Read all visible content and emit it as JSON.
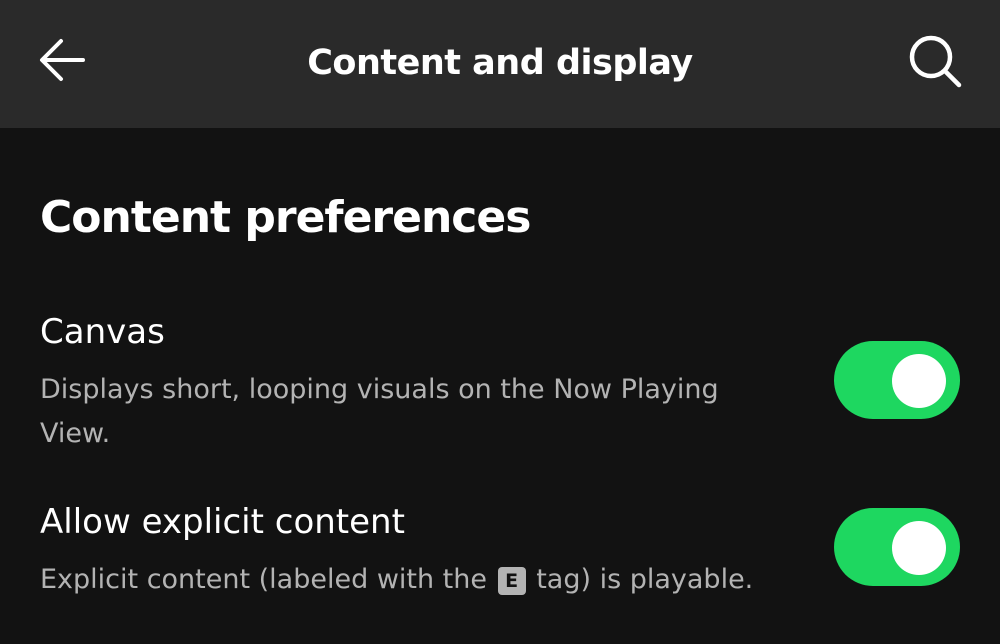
{
  "header": {
    "title": "Content and display",
    "back_icon": "arrow-left-icon",
    "search_icon": "search-icon"
  },
  "section": {
    "title": "Content preferences"
  },
  "settings": [
    {
      "label": "Canvas",
      "description": "Displays short, looping visuals on the Now Playing View.",
      "enabled": true
    },
    {
      "label": "Allow explicit content",
      "description_before": "Explicit content (labeled with the",
      "tag": "E",
      "description_after": "tag) is playable.",
      "enabled": true
    }
  ],
  "colors": {
    "background": "#121212",
    "header_background": "#2a2a2a",
    "accent": "#1ed760",
    "secondary_text": "#b3b3b3"
  }
}
